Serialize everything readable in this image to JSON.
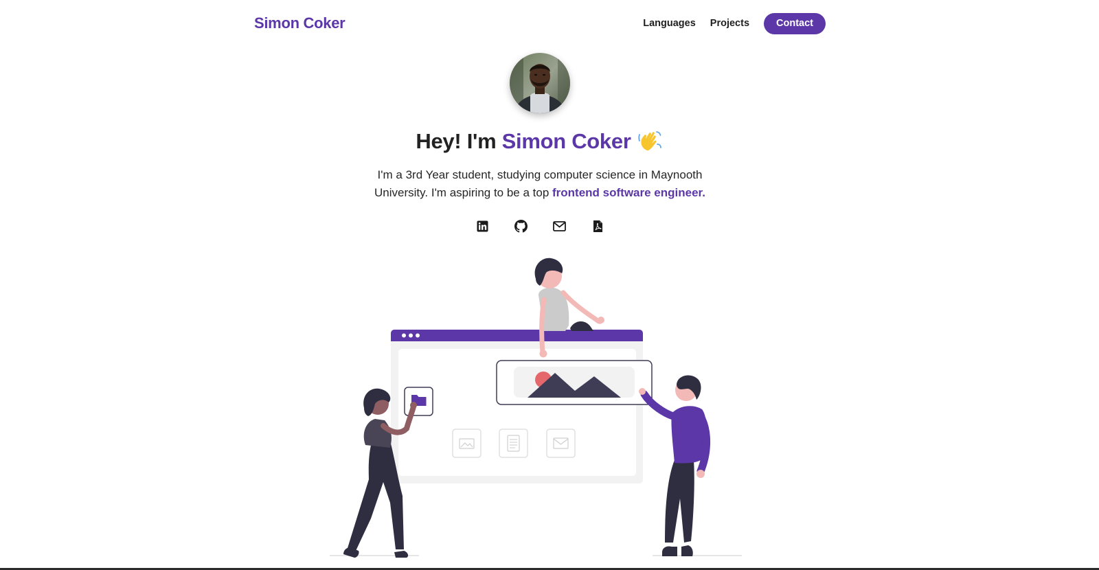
{
  "nav": {
    "brand": "Simon Coker",
    "links": [
      "Languages",
      "Projects"
    ],
    "contact_label": "Contact"
  },
  "hero": {
    "greeting": "Hey! I'm ",
    "name": "Simon Coker",
    "intro_text": "I'm a 3rd Year student, studying computer science in Maynooth University. I'm aspiring to be a top ",
    "intro_highlight": "frontend software engineer."
  },
  "socials": [
    {
      "icon": "linkedin-icon"
    },
    {
      "icon": "github-icon"
    },
    {
      "icon": "mail-icon"
    },
    {
      "icon": "pdf-icon"
    }
  ],
  "colors": {
    "accent": "#5b37a8",
    "text": "#222222",
    "illustration_dark": "#2f2e41",
    "illustration_pink": "#e4676c"
  }
}
